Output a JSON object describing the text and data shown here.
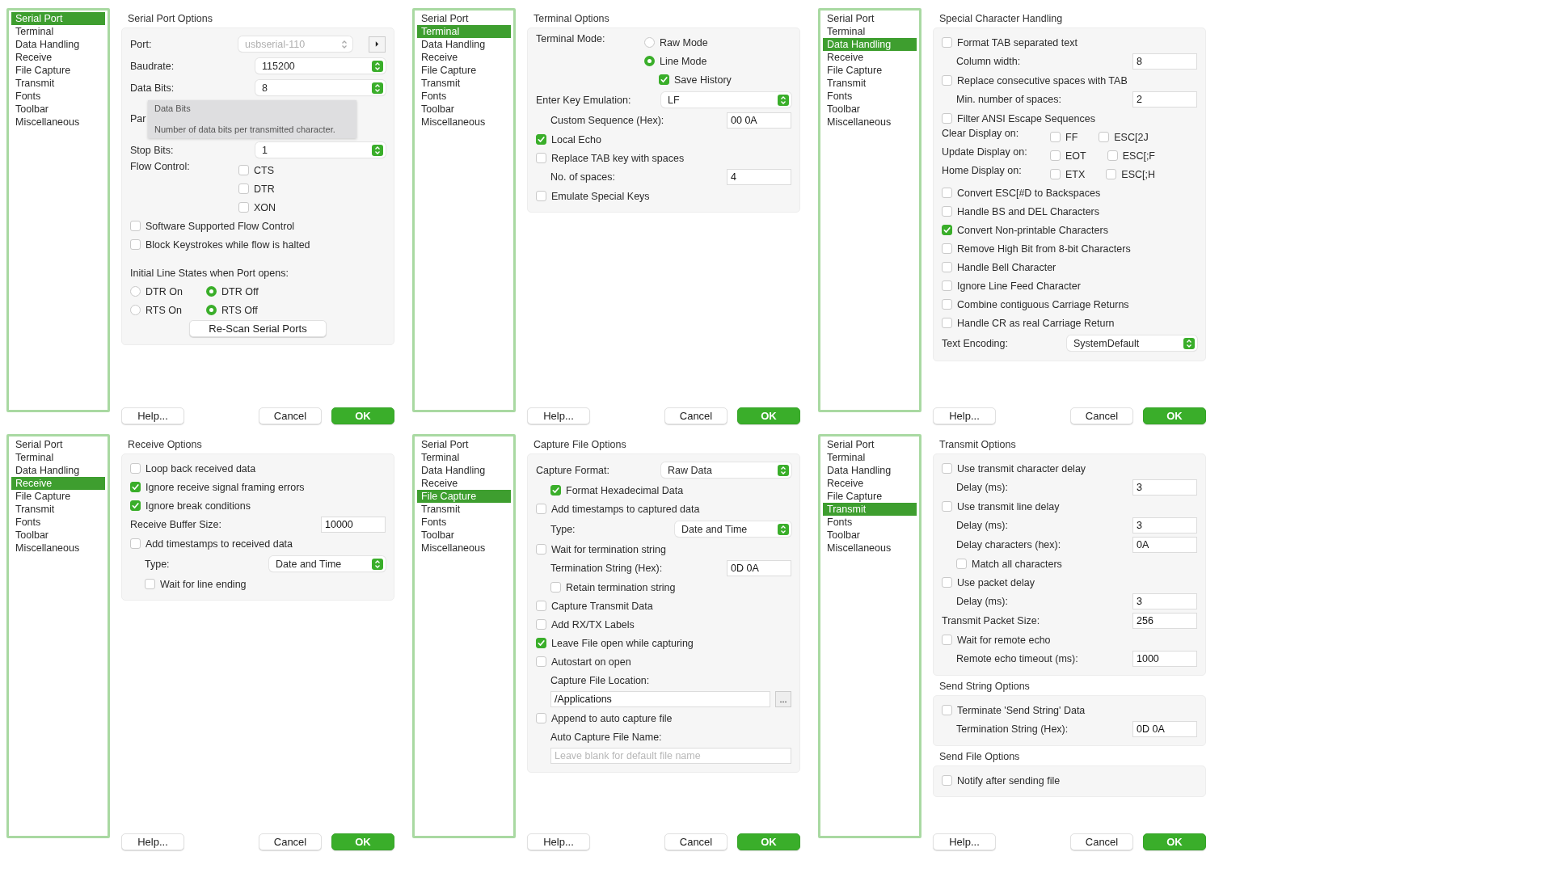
{
  "panels": [
    {
      "nav": [
        {
          "label": "Serial Port",
          "selected": true
        },
        {
          "label": "Terminal",
          "selected": false
        },
        {
          "label": "Data Handling",
          "selected": false
        },
        {
          "label": "Receive",
          "selected": false
        },
        {
          "label": "File Capture",
          "selected": false
        },
        {
          "label": "Transmit",
          "selected": false
        },
        {
          "label": "Fonts",
          "selected": false
        },
        {
          "label": "Toolbar",
          "selected": false
        },
        {
          "label": "Miscellaneous",
          "selected": false
        }
      ],
      "sections": [
        {
          "title": "Serial Port Options",
          "rows": [
            {
              "kind": "select",
              "label": "Port:",
              "value": "usbserial-110",
              "disabled": true,
              "side_button": true
            },
            {
              "kind": "select",
              "label": "Baudrate:",
              "value": "115200",
              "disabled": false
            },
            {
              "kind": "select",
              "label": "Data Bits:",
              "value": "8",
              "disabled": false
            },
            {
              "kind": "label",
              "label": "Par",
              "tooltip": {
                "title": "Data Bits",
                "text": "Number of data bits per transmitted character."
              }
            },
            {
              "kind": "select",
              "label": "Stop Bits:",
              "value": "1",
              "disabled": false
            },
            {
              "kind": "checklist",
              "label": "Flow Control:",
              "options": [
                {
                  "label": "CTS",
                  "checked": false
                },
                {
                  "label": "DTR",
                  "checked": false
                },
                {
                  "label": "XON",
                  "checked": false
                }
              ]
            },
            {
              "kind": "check",
              "label": "Software Supported Flow Control",
              "checked": false
            },
            {
              "kind": "check",
              "label": "Block Keystrokes while flow is halted",
              "checked": false
            },
            {
              "kind": "text",
              "label": "Initial Line States when Port opens:"
            },
            {
              "kind": "radiorow",
              "options": [
                {
                  "label": "DTR On",
                  "selected": false
                },
                {
                  "label": "DTR Off",
                  "selected": true
                }
              ]
            },
            {
              "kind": "radiorow",
              "options": [
                {
                  "label": "RTS On",
                  "selected": false
                },
                {
                  "label": "RTS Off",
                  "selected": true
                }
              ]
            },
            {
              "kind": "button",
              "label": "Re-Scan Serial Ports"
            }
          ]
        }
      ],
      "buttons": [
        {
          "label": "Help...",
          "kind": "help"
        },
        {
          "label": "Cancel",
          "kind": "cancel"
        },
        {
          "label": "OK",
          "kind": "default"
        }
      ]
    },
    {
      "nav": [
        {
          "label": "Serial Port",
          "selected": false
        },
        {
          "label": "Terminal",
          "selected": true
        },
        {
          "label": "Data Handling",
          "selected": false
        },
        {
          "label": "Receive",
          "selected": false
        },
        {
          "label": "File Capture",
          "selected": false
        },
        {
          "label": "Transmit",
          "selected": false
        },
        {
          "label": "Fonts",
          "selected": false
        },
        {
          "label": "Toolbar",
          "selected": false
        },
        {
          "label": "Miscellaneous",
          "selected": false
        }
      ],
      "sections": [
        {
          "title": "Terminal Options",
          "rows": [
            {
              "kind": "radiolist",
              "label": "Terminal Mode:",
              "options": [
                {
                  "label": "Raw Mode",
                  "selected": false
                },
                {
                  "label": "Line Mode",
                  "selected": true,
                  "children": [
                    {
                      "kind": "check",
                      "label": "Save History",
                      "checked": true
                    }
                  ]
                }
              ]
            },
            {
              "kind": "select",
              "label": "Enter Key Emulation:",
              "value": "LF",
              "disabled": false,
              "children": [
                {
                  "kind": "field",
                  "label": "Custom Sequence (Hex):",
                  "value": "00 0A"
                }
              ]
            },
            {
              "kind": "check",
              "label": "Local Echo",
              "checked": true
            },
            {
              "kind": "check",
              "label": "Replace TAB key with spaces",
              "checked": false,
              "children": [
                {
                  "kind": "field",
                  "label": "No. of spaces:",
                  "value": "4"
                }
              ]
            },
            {
              "kind": "check",
              "label": "Emulate Special Keys",
              "checked": false
            }
          ]
        }
      ],
      "buttons": [
        {
          "label": "Help...",
          "kind": "help"
        },
        {
          "label": "Cancel",
          "kind": "cancel"
        },
        {
          "label": "OK",
          "kind": "default"
        }
      ]
    },
    {
      "nav": [
        {
          "label": "Serial Port",
          "selected": false
        },
        {
          "label": "Terminal",
          "selected": false
        },
        {
          "label": "Data Handling",
          "selected": true
        },
        {
          "label": "Receive",
          "selected": false
        },
        {
          "label": "File Capture",
          "selected": false
        },
        {
          "label": "Transmit",
          "selected": false
        },
        {
          "label": "Fonts",
          "selected": false
        },
        {
          "label": "Toolbar",
          "selected": false
        },
        {
          "label": "Miscellaneous",
          "selected": false
        }
      ],
      "sections": [
        {
          "title": "Special Character Handling",
          "rows": [
            {
              "kind": "check",
              "label": "Format TAB separated text",
              "checked": false,
              "children": [
                {
                  "kind": "field",
                  "label": "Column width:",
                  "value": "8"
                }
              ]
            },
            {
              "kind": "check",
              "label": "Replace consecutive spaces with TAB",
              "checked": false,
              "children": [
                {
                  "kind": "field",
                  "label": "Min. number of spaces:",
                  "value": "2"
                }
              ]
            },
            {
              "kind": "check",
              "label": "Filter ANSI Escape Sequences",
              "checked": false
            },
            {
              "kind": "checkrow",
              "label": "Clear Display on:",
              "options": [
                {
                  "label": "FF",
                  "checked": false
                },
                {
                  "label": "ESC[2J",
                  "checked": false
                }
              ]
            },
            {
              "kind": "checkrow",
              "label": "Update Display on:",
              "options": [
                {
                  "label": "EOT",
                  "checked": false
                },
                {
                  "label": "ESC[;F",
                  "checked": false
                }
              ]
            },
            {
              "kind": "checkrow",
              "label": "Home Display on:",
              "options": [
                {
                  "label": "ETX",
                  "checked": false
                },
                {
                  "label": "ESC[;H",
                  "checked": false
                }
              ]
            },
            {
              "kind": "check",
              "label": "Convert ESC[#D to Backspaces",
              "checked": false
            },
            {
              "kind": "check",
              "label": "Handle BS and DEL Characters",
              "checked": false
            },
            {
              "kind": "check",
              "label": "Convert Non-printable Characters",
              "checked": true
            },
            {
              "kind": "check",
              "label": "Remove High Bit from 8-bit Characters",
              "checked": false
            },
            {
              "kind": "check",
              "label": "Handle Bell Character",
              "checked": false
            },
            {
              "kind": "check",
              "label": "Ignore Line Feed Character",
              "checked": false
            },
            {
              "kind": "check",
              "label": "Combine contiguous Carriage Returns",
              "checked": false
            },
            {
              "kind": "check",
              "label": "Handle CR as real Carriage Return",
              "checked": false
            },
            {
              "kind": "select",
              "label": "Text Encoding:",
              "value": "SystemDefault",
              "disabled": false
            }
          ]
        }
      ],
      "buttons": [
        {
          "label": "Help...",
          "kind": "help"
        },
        {
          "label": "Cancel",
          "kind": "cancel"
        },
        {
          "label": "OK",
          "kind": "default"
        }
      ]
    },
    {
      "nav": [
        {
          "label": "Serial Port",
          "selected": false
        },
        {
          "label": "Terminal",
          "selected": false
        },
        {
          "label": "Data Handling",
          "selected": false
        },
        {
          "label": "Receive",
          "selected": true
        },
        {
          "label": "File Capture",
          "selected": false
        },
        {
          "label": "Transmit",
          "selected": false
        },
        {
          "label": "Fonts",
          "selected": false
        },
        {
          "label": "Toolbar",
          "selected": false
        },
        {
          "label": "Miscellaneous",
          "selected": false
        }
      ],
      "sections": [
        {
          "title": "Receive Options",
          "rows": [
            {
              "kind": "check",
              "label": "Loop back received data",
              "checked": false
            },
            {
              "kind": "check",
              "label": "Ignore receive signal framing errors",
              "checked": true
            },
            {
              "kind": "check",
              "label": "Ignore break conditions",
              "checked": true
            },
            {
              "kind": "field",
              "label": "Receive Buffer Size:",
              "value": "10000"
            },
            {
              "kind": "check",
              "label": "Add timestamps to received data",
              "checked": false,
              "children": [
                {
                  "kind": "select",
                  "label": "Type:",
                  "value": "Date and Time",
                  "disabled": false
                },
                {
                  "kind": "check",
                  "label": "Wait for line ending",
                  "checked": false
                }
              ]
            }
          ]
        }
      ],
      "buttons": [
        {
          "label": "Help...",
          "kind": "help"
        },
        {
          "label": "Cancel",
          "kind": "cancel"
        },
        {
          "label": "OK",
          "kind": "default"
        }
      ]
    },
    {
      "nav": [
        {
          "label": "Serial Port",
          "selected": false
        },
        {
          "label": "Terminal",
          "selected": false
        },
        {
          "label": "Data Handling",
          "selected": false
        },
        {
          "label": "Receive",
          "selected": false
        },
        {
          "label": "File Capture",
          "selected": true
        },
        {
          "label": "Transmit",
          "selected": false
        },
        {
          "label": "Fonts",
          "selected": false
        },
        {
          "label": "Toolbar",
          "selected": false
        },
        {
          "label": "Miscellaneous",
          "selected": false
        }
      ],
      "sections": [
        {
          "title": "Capture File Options",
          "rows": [
            {
              "kind": "select",
              "label": "Capture Format:",
              "value": "Raw Data",
              "disabled": false,
              "children": [
                {
                  "kind": "check",
                  "label": "Format Hexadecimal Data",
                  "checked": true
                }
              ]
            },
            {
              "kind": "check",
              "label": "Add timestamps to captured data",
              "checked": false,
              "children": [
                {
                  "kind": "select",
                  "label": "Type:",
                  "value": "Date and Time",
                  "disabled": false
                }
              ]
            },
            {
              "kind": "check",
              "label": "Wait for termination string",
              "checked": false,
              "children": [
                {
                  "kind": "field",
                  "label": "Termination String (Hex):",
                  "value": "0D 0A"
                },
                {
                  "kind": "check",
                  "label": "Retain termination string",
                  "checked": false
                }
              ]
            },
            {
              "kind": "check",
              "label": "Capture Transmit Data",
              "checked": false
            },
            {
              "kind": "check",
              "label": "Add RX/TX Labels",
              "checked": false
            },
            {
              "kind": "check",
              "label": "Leave File open while capturing",
              "checked": true
            },
            {
              "kind": "check",
              "label": "Autostart on open",
              "checked": false
            },
            {
              "kind": "caption",
              "label": "Capture File Location:"
            },
            {
              "kind": "path",
              "value": "/Applications",
              "browse": "..."
            },
            {
              "kind": "check",
              "label": "Append to auto capture file",
              "checked": false
            },
            {
              "kind": "caption",
              "label": "Auto Capture File Name:"
            },
            {
              "kind": "path",
              "placeholder": "Leave blank for default file name"
            }
          ]
        }
      ],
      "buttons": [
        {
          "label": "Help...",
          "kind": "help"
        },
        {
          "label": "Cancel",
          "kind": "cancel"
        },
        {
          "label": "OK",
          "kind": "default"
        }
      ]
    },
    {
      "nav": [
        {
          "label": "Serial Port",
          "selected": false
        },
        {
          "label": "Terminal",
          "selected": false
        },
        {
          "label": "Data Handling",
          "selected": false
        },
        {
          "label": "Receive",
          "selected": false
        },
        {
          "label": "File Capture",
          "selected": false
        },
        {
          "label": "Transmit",
          "selected": true
        },
        {
          "label": "Fonts",
          "selected": false
        },
        {
          "label": "Toolbar",
          "selected": false
        },
        {
          "label": "Miscellaneous",
          "selected": false
        }
      ],
      "sections": [
        {
          "title": "Transmit Options",
          "rows": [
            {
              "kind": "check",
              "label": "Use transmit character delay",
              "checked": false,
              "children": [
                {
                  "kind": "field",
                  "label": "Delay (ms):",
                  "value": "3"
                }
              ]
            },
            {
              "kind": "check",
              "label": "Use transmit line delay",
              "checked": false,
              "children": [
                {
                  "kind": "field",
                  "label": "Delay (ms):",
                  "value": "3"
                },
                {
                  "kind": "field",
                  "label": "Delay characters (hex):",
                  "value": "0A"
                },
                {
                  "kind": "check",
                  "label": "Match all characters",
                  "checked": false
                }
              ]
            },
            {
              "kind": "check",
              "label": "Use packet delay",
              "checked": false,
              "children": [
                {
                  "kind": "field",
                  "label": "Delay (ms):",
                  "value": "3"
                }
              ]
            },
            {
              "kind": "field",
              "label": "Transmit Packet Size:",
              "value": "256"
            },
            {
              "kind": "check",
              "label": "Wait for remote echo",
              "checked": false,
              "children": [
                {
                  "kind": "field",
                  "label": "Remote echo timeout (ms):",
                  "value": "1000"
                }
              ]
            }
          ]
        },
        {
          "title": "Send String Options",
          "rows": [
            {
              "kind": "check",
              "label": "Terminate 'Send String' Data",
              "checked": false,
              "children": [
                {
                  "kind": "field",
                  "label": "Termination String (Hex):",
                  "value": "0D 0A"
                }
              ]
            }
          ]
        },
        {
          "title": "Send File Options",
          "rows": [
            {
              "kind": "check",
              "label": "Notify after sending file",
              "checked": false
            }
          ]
        }
      ],
      "buttons": [
        {
          "label": "Help...",
          "kind": "help"
        },
        {
          "label": "Cancel",
          "kind": "cancel"
        },
        {
          "label": "OK",
          "kind": "default"
        }
      ]
    }
  ]
}
